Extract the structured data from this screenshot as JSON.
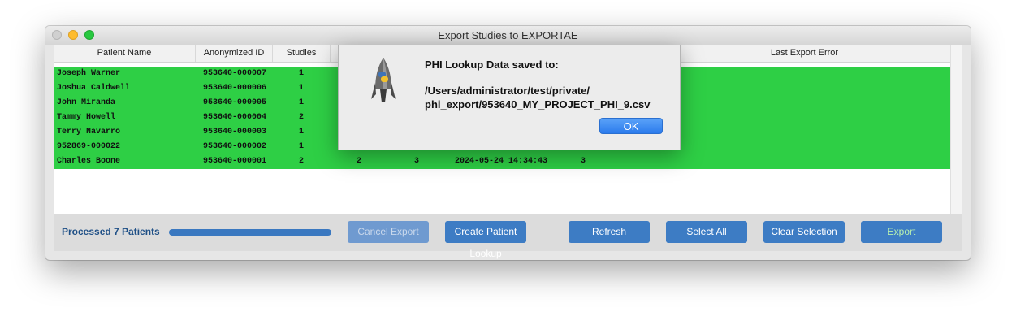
{
  "window": {
    "title": "Export Studies to EXPORTAE"
  },
  "table": {
    "columns": [
      "Patient Name",
      "Anonymized ID",
      "Studies",
      "",
      "",
      "",
      "",
      "Last Export Error"
    ],
    "rows": [
      [
        "Joseph Warner",
        "953640-000007",
        "1",
        "",
        "",
        "",
        ""
      ],
      [
        "Joshua Caldwell",
        "953640-000006",
        "1",
        "",
        "",
        "",
        ""
      ],
      [
        "John Miranda",
        "953640-000005",
        "1",
        "",
        "",
        "",
        ""
      ],
      [
        "Tammy Howell",
        "953640-000004",
        "2",
        "",
        "",
        "",
        ""
      ],
      [
        "Terry Navarro",
        "953640-000003",
        "1",
        "",
        "",
        "",
        ""
      ],
      [
        "952869-000022",
        "953640-000002",
        "1",
        "",
        "",
        "",
        ""
      ],
      [
        "Charles Boone",
        "953640-000001",
        "2",
        "2",
        "3",
        "2024-05-24 14:34:43",
        "3"
      ]
    ],
    "row_color": "#2ecf45"
  },
  "bottom": {
    "status": "Processed 7 Patients",
    "progress": 1.0,
    "buttons": {
      "cancel": "Cancel Export",
      "lookup": "Create Patient Lookup",
      "refresh": "Refresh",
      "select_all": "Select All",
      "clear": "Clear Selection",
      "export": "Export"
    }
  },
  "dialog": {
    "heading": "PHI Lookup Data saved to:",
    "path_line1": "/Users/administrator/test/private/",
    "path_line2": "phi_export/953640_MY_PROJECT_PHI_9.csv",
    "ok": "OK",
    "icon": "python-rocket-icon"
  }
}
